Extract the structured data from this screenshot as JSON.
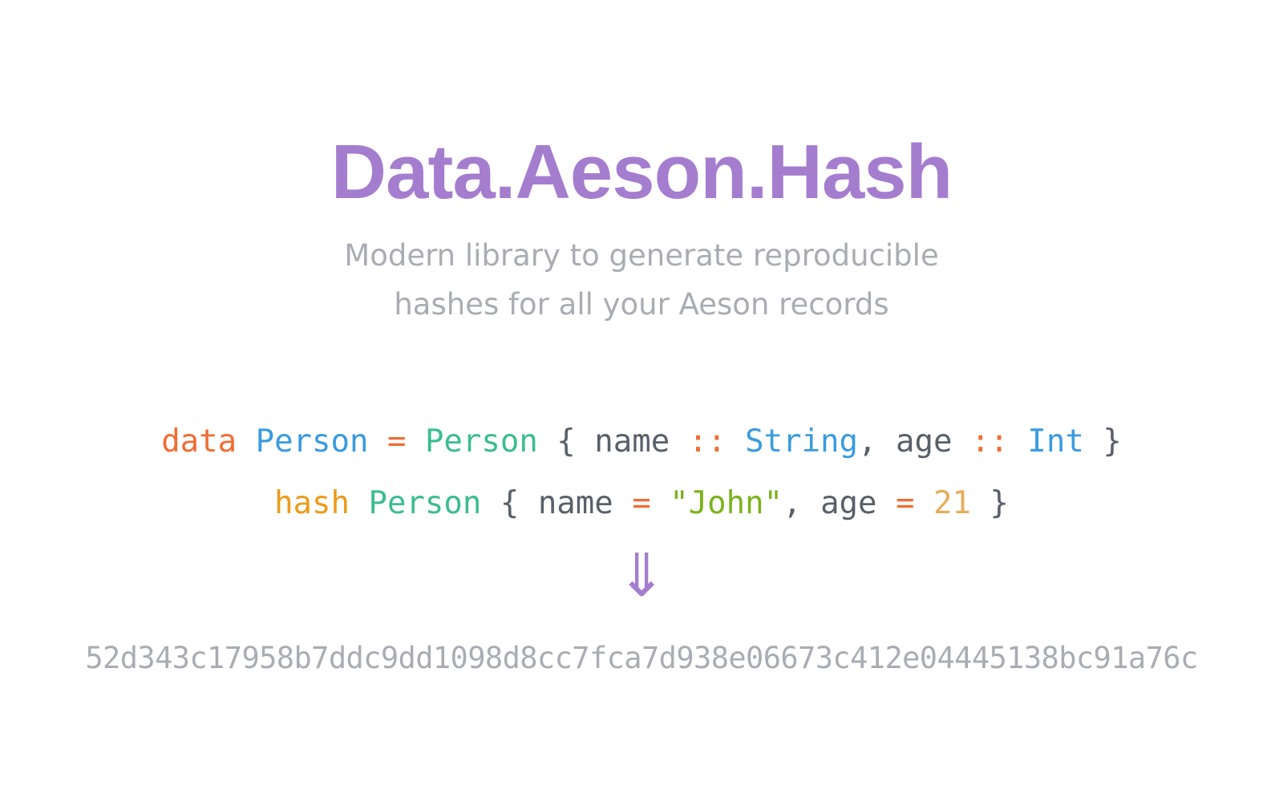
{
  "header": {
    "title": "Data.Aeson.Hash",
    "subtitle_line1": "Modern library to generate reproducible",
    "subtitle_line2": "hashes for all your Aeson records"
  },
  "code": {
    "line1": [
      {
        "text": "data",
        "color": "#f16d34"
      },
      {
        "text": " ",
        "color": "#59606a"
      },
      {
        "text": "Person",
        "color": "#3a9be0"
      },
      {
        "text": " ",
        "color": "#59606a"
      },
      {
        "text": "=",
        "color": "#f16d34"
      },
      {
        "text": " ",
        "color": "#59606a"
      },
      {
        "text": "Person",
        "color": "#3dbd8f"
      },
      {
        "text": " { ",
        "color": "#59606a"
      },
      {
        "text": "name",
        "color": "#59606a"
      },
      {
        "text": " ",
        "color": "#59606a"
      },
      {
        "text": "::",
        "color": "#f16d34"
      },
      {
        "text": " ",
        "color": "#59606a"
      },
      {
        "text": "String",
        "color": "#3a9be0"
      },
      {
        "text": ", ",
        "color": "#59606a"
      },
      {
        "text": "age",
        "color": "#59606a"
      },
      {
        "text": " ",
        "color": "#59606a"
      },
      {
        "text": "::",
        "color": "#f16d34"
      },
      {
        "text": " ",
        "color": "#59606a"
      },
      {
        "text": "Int",
        "color": "#3a9be0"
      },
      {
        "text": " }",
        "color": "#59606a"
      }
    ],
    "line2": [
      {
        "text": "hash",
        "color": "#ee9a1a"
      },
      {
        "text": " ",
        "color": "#59606a"
      },
      {
        "text": "Person",
        "color": "#3dbd8f"
      },
      {
        "text": " { ",
        "color": "#59606a"
      },
      {
        "text": "name",
        "color": "#59606a"
      },
      {
        "text": " ",
        "color": "#59606a"
      },
      {
        "text": "=",
        "color": "#f16d34"
      },
      {
        "text": " ",
        "color": "#59606a"
      },
      {
        "text": "\"John\"",
        "color": "#7cb21c"
      },
      {
        "text": ", ",
        "color": "#59606a"
      },
      {
        "text": "age",
        "color": "#59606a"
      },
      {
        "text": " ",
        "color": "#59606a"
      },
      {
        "text": "=",
        "color": "#f16d34"
      },
      {
        "text": " ",
        "color": "#59606a"
      },
      {
        "text": "21",
        "color": "#e6ad5d"
      },
      {
        "text": " }",
        "color": "#59606a"
      }
    ]
  },
  "arrow": {
    "glyph": "⇓",
    "icon": "double-down-arrow-icon"
  },
  "result": {
    "hash": "52d343c17958b7ddc9dd1098d8cc7fca7d938e06673c412e04445138bc91a76c"
  },
  "colors": {
    "accent": "#a57dcf",
    "subtitle": "#a9adb3",
    "hash": "#a9adb3",
    "code_default": "#59606a"
  }
}
